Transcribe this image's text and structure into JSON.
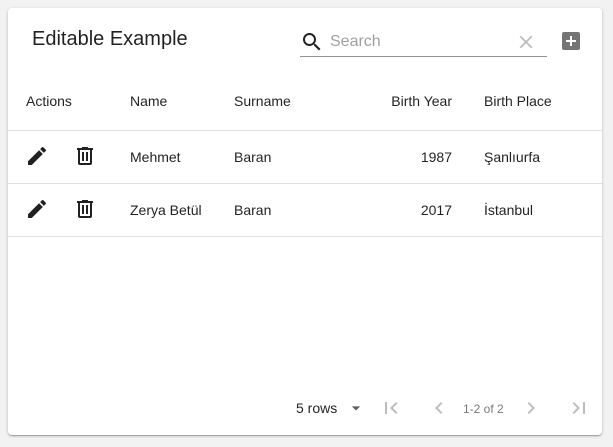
{
  "table": {
    "title": "Editable Example",
    "search": {
      "placeholder": "Search",
      "value": ""
    },
    "columns": [
      "Actions",
      "Name",
      "Surname",
      "Birth Year",
      "Birth Place"
    ],
    "rows": [
      {
        "name": "Mehmet",
        "surname": "Baran",
        "birth_year": "1987",
        "birth_place": "Şanlıurfa"
      },
      {
        "name": "Zerya Betül",
        "surname": "Baran",
        "birth_year": "2017",
        "birth_place": "İstanbul"
      }
    ],
    "row_actions": [
      "edit-icon",
      "delete-icon"
    ],
    "toolbar_actions": [
      "add-box-icon"
    ]
  },
  "pagination": {
    "rows_per_page_label": "5 rows",
    "range_label": "1-2 of 2",
    "icons": [
      "first-page-icon",
      "previous-page-icon",
      "next-page-icon",
      "last-page-icon"
    ]
  },
  "colors": {
    "background": "#f2f2f2",
    "card": "#ffffff",
    "divider": "#e0e0e0",
    "icon_dark": "#212121",
    "icon_disabled": "#bdbdbd",
    "add_icon": "#757575"
  }
}
